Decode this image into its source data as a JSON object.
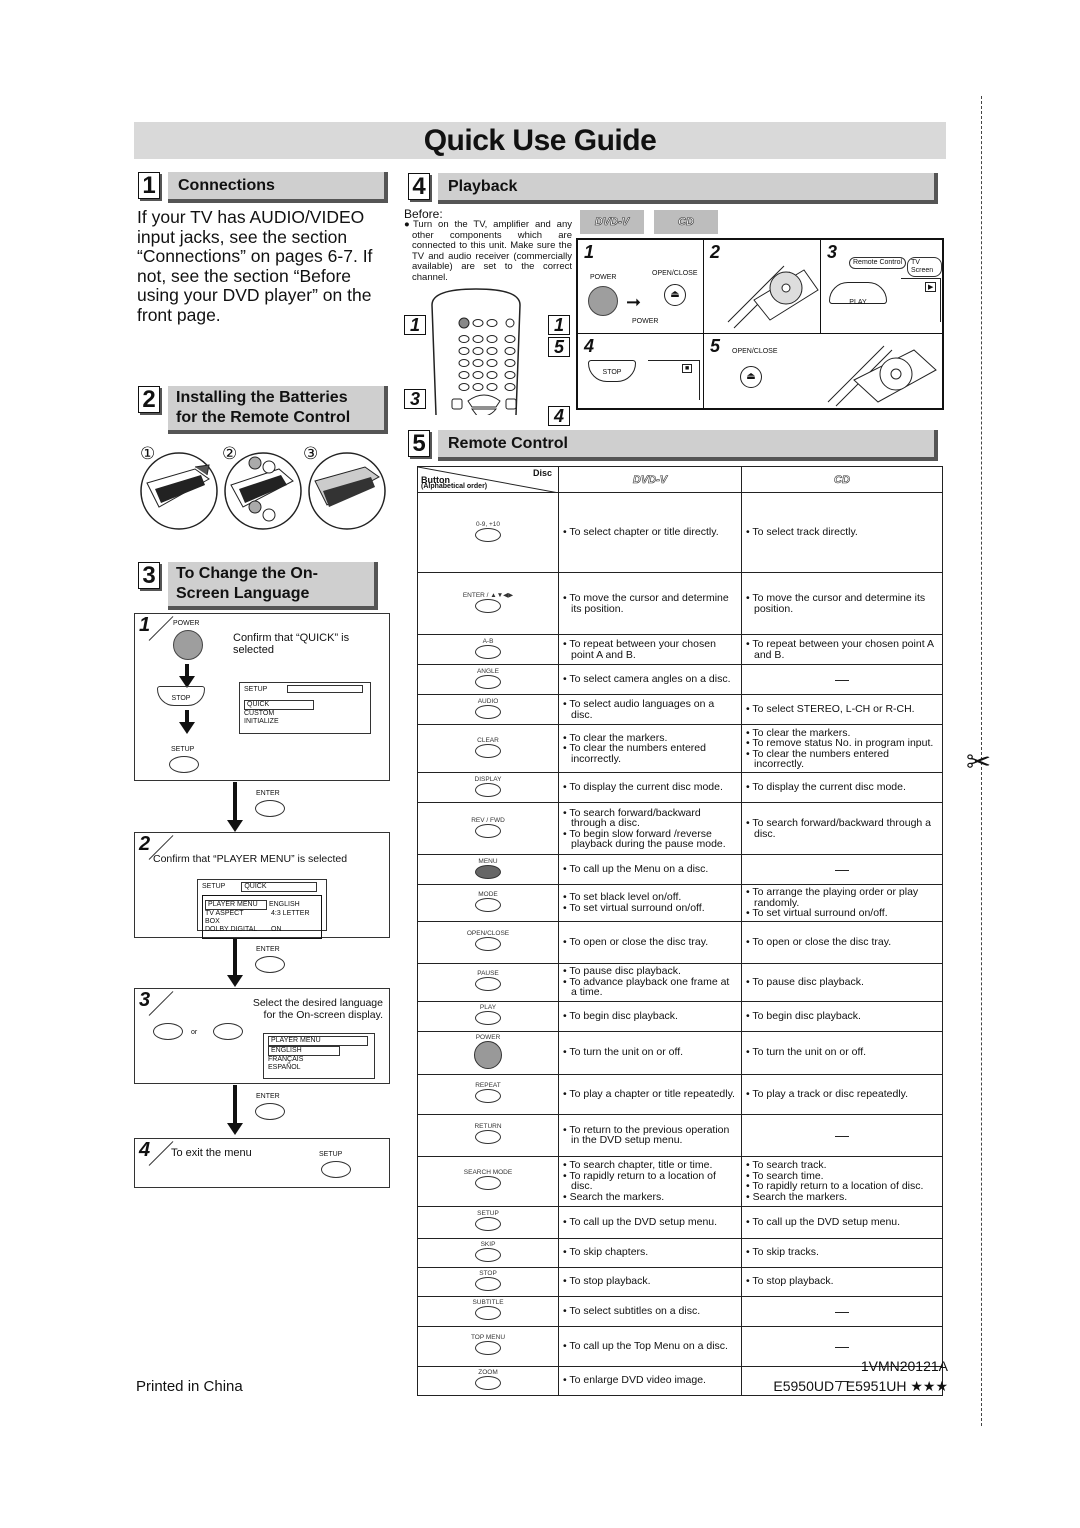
{
  "page": {
    "title": "Quick Use Guide",
    "footer_left": "Printed in China",
    "footer_code": "1VMN20121A",
    "footer_model": "E5950UD / E5951UH ★★★"
  },
  "sections": {
    "connections": {
      "number": "1",
      "title": "Connections",
      "body": "If your TV has AUDIO/VIDEO input jacks, see the section “Connections” on pages 6-7. If not, see the section “Before using your DVD player” on the front page."
    },
    "batteries": {
      "number": "2",
      "title_line1": "Installing the Batteries",
      "title_line2": "for the Remote Control",
      "steps": [
        "①",
        "②",
        "③"
      ]
    },
    "language": {
      "number": "3",
      "title_line1": "To Change the On-",
      "title_line2": "Screen Language",
      "step1": {
        "num": "1",
        "text": "Confirm that “QUICK” is selected",
        "btn_power": "POWER",
        "btn_stop": "STOP",
        "btn_setup": "SETUP",
        "osd_title": "SETUP",
        "osd_items": [
          "QUICK",
          "CUSTOM",
          "INITIALIZE"
        ]
      },
      "enter_label": "ENTER",
      "step2": {
        "num": "2",
        "text": "Confirm that “PLAYER MENU” is selected",
        "osd_title": "SETUP",
        "osd_value": "QUICK",
        "rows": [
          {
            "k": "PLAYER MENU",
            "v": "ENGLISH"
          },
          {
            "k": "TV ASPECT",
            "v": "4:3 LETTER BOX"
          },
          {
            "k": "DOLBY DIGITAL",
            "v": "ON"
          }
        ]
      },
      "step3": {
        "num": "3",
        "text_line1": "Select the desired language",
        "text_line2": "for the On-screen display.",
        "or": "or",
        "osd_title": "PLAYER MENU",
        "osd_items": [
          "ENGLISH",
          "FRANÇAIS",
          "ESPAÑOL"
        ]
      },
      "step4": {
        "num": "4",
        "text": "To exit the menu",
        "btn_setup": "SETUP"
      }
    },
    "playback": {
      "number": "4",
      "title": "Playback",
      "before_label": "Before:",
      "before_text": "Turn on the TV, amplifier and any other components which are connected to this unit. Make sure the TV and audio receiver (commercially available) are set to the correct channel.",
      "disc_logos": [
        "DVD-V",
        "CD"
      ],
      "remote_callouts": [
        "1",
        "1",
        "5",
        "3",
        "4"
      ],
      "steps": [
        {
          "num": "1",
          "labels": [
            "POWER",
            "OPEN/CLOSE",
            "POWER"
          ]
        },
        {
          "num": "2",
          "labels": []
        },
        {
          "num": "3",
          "labels": [
            "Remote Control",
            "TV Screen",
            "PLAY"
          ]
        },
        {
          "num": "4",
          "labels": [
            "STOP"
          ]
        },
        {
          "num": "5",
          "labels": [
            "OPEN/CLOSE"
          ]
        }
      ]
    },
    "remote": {
      "number": "5",
      "title": "Remote Control",
      "header": {
        "button": "Button",
        "order": "(Alphabetical order)",
        "disc": "Disc",
        "col_dvd": "DVD-V",
        "col_cd": "CD"
      },
      "rows": [
        {
          "button": "0-9, +10",
          "dvd": [
            "To select chapter or title directly."
          ],
          "cd": [
            "To select track directly."
          ]
        },
        {
          "button": "ENTER / ▲▼◀▶",
          "dvd": [
            "To move the cursor and determine its position."
          ],
          "cd": [
            "To move the cursor and determine its position."
          ]
        },
        {
          "button": "A-B",
          "dvd": [
            "To repeat between your chosen point A and B."
          ],
          "cd": [
            "To repeat between your chosen point A and B."
          ]
        },
        {
          "button": "ANGLE",
          "dvd": [
            "To select camera angles on a disc."
          ],
          "cd": []
        },
        {
          "button": "AUDIO",
          "dvd": [
            "To select audio languages on a disc."
          ],
          "cd": [
            "To select STEREO, L-CH or R-CH."
          ]
        },
        {
          "button": "CLEAR",
          "dvd": [
            "To clear the markers.",
            "To clear the numbers entered incorrectly."
          ],
          "cd": [
            "To clear the markers.",
            "To remove status No. in program input.",
            "To clear the numbers entered incorrectly."
          ]
        },
        {
          "button": "DISPLAY",
          "dvd": [
            "To display the current disc mode."
          ],
          "cd": [
            "To display the current disc mode."
          ]
        },
        {
          "button": "REV / FWD",
          "dvd": [
            "To search forward/backward through a disc.",
            "To begin slow forward /reverse playback during the pause mode."
          ],
          "cd": [
            "To search forward/backward through a disc."
          ]
        },
        {
          "button": "MENU",
          "dvd": [
            "To call up the Menu on a disc."
          ],
          "cd": []
        },
        {
          "button": "MODE",
          "dvd": [
            "To set black level on/off.",
            "To set virtual surround on/off."
          ],
          "cd": [
            "To arrange the playing order or play randomly.",
            "To set virtual surround on/off."
          ]
        },
        {
          "button": "OPEN/CLOSE",
          "dvd": [
            "To open or close the disc tray."
          ],
          "cd": [
            "To open or close the disc tray."
          ]
        },
        {
          "button": "PAUSE",
          "dvd": [
            "To pause disc playback.",
            "To advance playback one frame at a time."
          ],
          "cd": [
            "To pause disc playback."
          ]
        },
        {
          "button": "PLAY",
          "dvd": [
            "To begin disc playback."
          ],
          "cd": [
            "To begin disc playback."
          ]
        },
        {
          "button": "POWER",
          "dvd": [
            "To turn the unit on or off."
          ],
          "cd": [
            "To turn the unit on or off."
          ]
        },
        {
          "button": "REPEAT",
          "dvd": [
            "To play a chapter or title repeatedly."
          ],
          "cd": [
            "To play a track or disc repeatedly."
          ]
        },
        {
          "button": "RETURN",
          "dvd": [
            "To return to the previous operation in the DVD setup menu."
          ],
          "cd": []
        },
        {
          "button": "SEARCH MODE",
          "dvd": [
            "To search chapter, title or time.",
            "To rapidly return to a location of disc.",
            "Search the markers."
          ],
          "cd": [
            "To search track.",
            "To search time.",
            "To rapidly return to a location of disc.",
            "Search the markers."
          ]
        },
        {
          "button": "SETUP",
          "dvd": [
            "To call up the DVD setup menu."
          ],
          "cd": [
            "To call up the DVD setup menu."
          ]
        },
        {
          "button": "SKIP",
          "dvd": [
            "To skip chapters."
          ],
          "cd": [
            "To skip tracks."
          ]
        },
        {
          "button": "STOP",
          "dvd": [
            "To stop playback."
          ],
          "cd": [
            "To stop playback."
          ]
        },
        {
          "button": "SUBTITLE",
          "dvd": [
            "To select subtitles on a disc."
          ],
          "cd": []
        },
        {
          "button": "TOP MENU",
          "dvd": [
            "To call up the Top Menu on a disc."
          ],
          "cd": []
        },
        {
          "button": "ZOOM",
          "dvd": [
            "To enlarge DVD video image."
          ],
          "cd": []
        }
      ]
    }
  }
}
